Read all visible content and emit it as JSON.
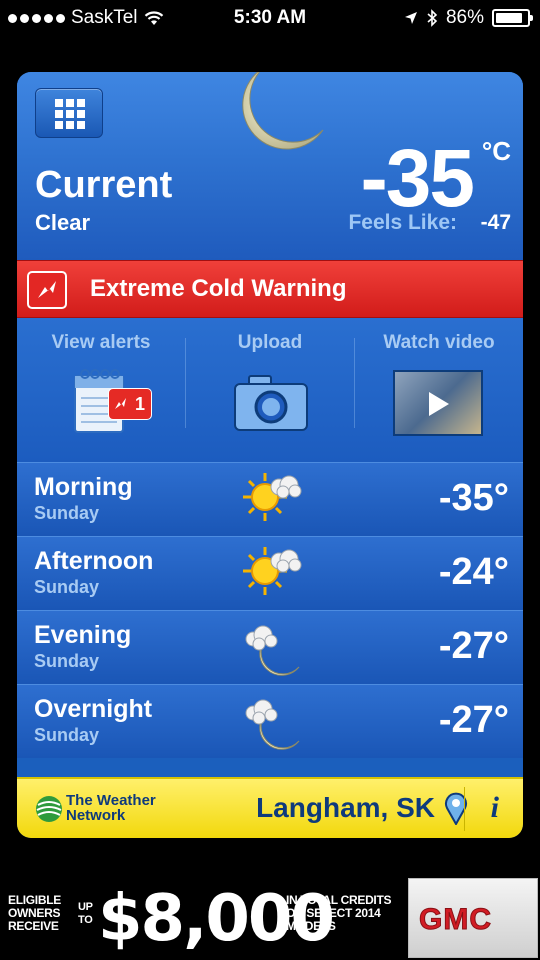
{
  "status_bar": {
    "carrier": "SaskTel",
    "time": "5:30 AM",
    "battery_percent": "86%",
    "battery_level": 0.86
  },
  "current": {
    "title": "Current",
    "condition": "Clear",
    "temperature": "-35",
    "unit": "°C",
    "feels_like_label": "Feels Like:",
    "feels_like_value": "-47",
    "icon": "moon-icon"
  },
  "warning": {
    "text": "Extreme Cold Warning"
  },
  "actions": [
    {
      "label": "View alerts",
      "badge": "1"
    },
    {
      "label": "Upload"
    },
    {
      "label": "Watch video"
    }
  ],
  "forecast": [
    {
      "period": "Morning",
      "day": "Sunday",
      "temp": "-35°",
      "icon": "sun-cloud-icon"
    },
    {
      "period": "Afternoon",
      "day": "Sunday",
      "temp": "-24°",
      "icon": "sun-cloud-icon"
    },
    {
      "period": "Evening",
      "day": "Sunday",
      "temp": "-27°",
      "icon": "moon-cloud-icon"
    },
    {
      "period": "Overnight",
      "day": "Sunday",
      "temp": "-27°",
      "icon": "moon-cloud-icon"
    }
  ],
  "footer": {
    "brand": "The Weather Network",
    "location": "Langham, SK",
    "info": "i"
  },
  "ad": {
    "left_text": "ELIGIBLE OWNERS RECEIVE",
    "up_to": "UP TO",
    "amount": "$8,000",
    "right_text": "IN TOTAL CREDITS ON SELECT 2014 MODELS",
    "logo": "GMC"
  },
  "colors": {
    "accent_blue": "#1f5bbd",
    "warning_red": "#e32724",
    "footer_yellow": "#f6e22a"
  }
}
